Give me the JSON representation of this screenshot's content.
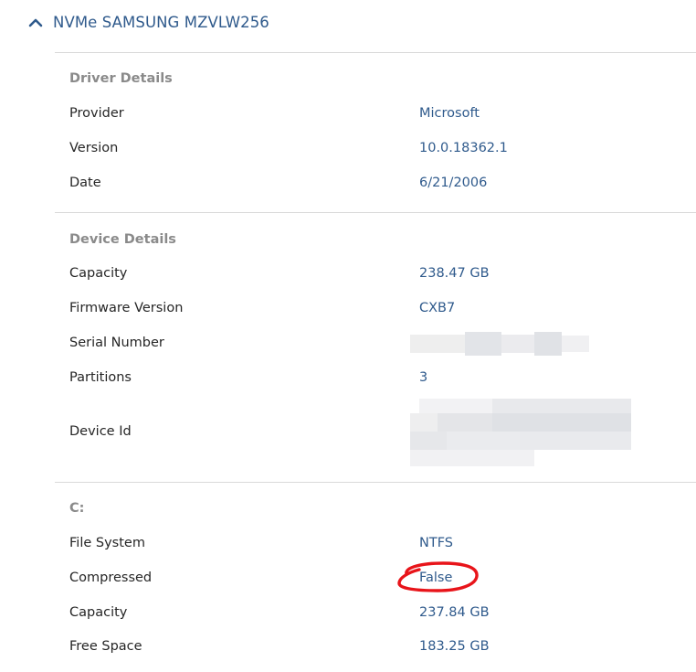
{
  "device": {
    "title": "NVMe SAMSUNG MZVLW256",
    "expand_icon": "chevron-up-icon"
  },
  "driver_details": {
    "heading": "Driver Details",
    "provider_label": "Provider",
    "provider_value": "Microsoft",
    "version_label": "Version",
    "version_value": "10.0.18362.1",
    "date_label": "Date",
    "date_value": "6/21/2006"
  },
  "device_details": {
    "heading": "Device Details",
    "capacity_label": "Capacity",
    "capacity_value": "238.47 GB",
    "firmware_label": "Firmware Version",
    "firmware_value": "CXB7",
    "serial_label": "Serial Number",
    "partitions_label": "Partitions",
    "partitions_value": "3",
    "device_id_label": "Device Id"
  },
  "volume": {
    "heading": "C:",
    "fs_label": "File System",
    "fs_value": "NTFS",
    "compressed_label": "Compressed",
    "compressed_value": "False",
    "capacity_label": "Capacity",
    "capacity_value": "237.84 GB",
    "free_label": "Free Space",
    "free_value": "183.25 GB"
  },
  "colors": {
    "accent": "#2f5a8c",
    "label": "#262626",
    "heading": "#8a8a8a",
    "annotation": "#e8141a"
  }
}
